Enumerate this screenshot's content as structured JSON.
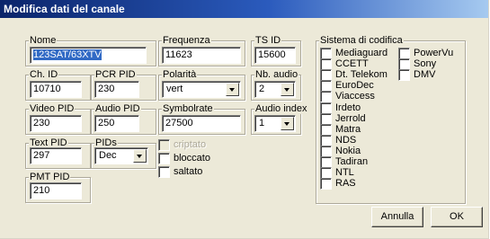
{
  "window": {
    "title": "Modifica dati del canale"
  },
  "fields": {
    "nome": {
      "label": "Nome",
      "value": "123SAT/63XTV"
    },
    "frequenza": {
      "label": "Frequenza",
      "value": "11623"
    },
    "ts_id": {
      "label": "TS ID",
      "value": "15600"
    },
    "ch_id": {
      "label": "Ch. ID",
      "value": "10710"
    },
    "pcr_pid": {
      "label": "PCR PID",
      "value": "230"
    },
    "polarita": {
      "label": "Polarità",
      "value": "vert"
    },
    "nb_audio": {
      "label": "Nb. audio",
      "value": "2"
    },
    "video_pid": {
      "label": "Video PID",
      "value": "230"
    },
    "audio_pid": {
      "label": "Audio PID",
      "value": "250"
    },
    "symbolrate": {
      "label": "Symbolrate",
      "value": "27500"
    },
    "audio_index": {
      "label": "Audio index",
      "value": "1"
    },
    "text_pid": {
      "label": "Text PID",
      "value": "297"
    },
    "pids": {
      "label": "PIDs",
      "value": "Dec"
    },
    "pmt_pid": {
      "label": "PMT PID",
      "value": "210"
    }
  },
  "flags": [
    {
      "label": "criptato",
      "checked": false,
      "disabled": true
    },
    {
      "label": "bloccato",
      "checked": false,
      "disabled": false
    },
    {
      "label": "saltato",
      "checked": false,
      "disabled": false
    }
  ],
  "codifica": {
    "label": "Sistema di codifica",
    "col1": [
      "Mediaguard",
      "CCETT",
      "Dt. Telekom",
      "EuroDec",
      "Viaccess",
      "Irdeto",
      "Jerrold",
      "Matra",
      "NDS",
      "Nokia",
      "Tadiran",
      "NTL",
      "RAS"
    ],
    "col2": [
      "PowerVu",
      "Sony",
      "DMV"
    ]
  },
  "buttons": {
    "annulla": "Annulla",
    "ok": "OK"
  }
}
